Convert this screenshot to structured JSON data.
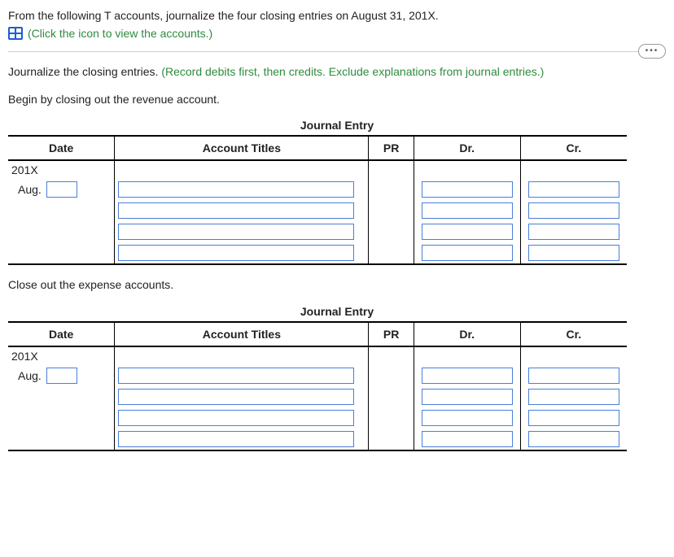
{
  "intro": {
    "line1": "From the following T accounts, journalize the four closing entries on August 31, 201X.",
    "link_text": "(Click the icon to view the accounts.)"
  },
  "main_instruction": "Journalize the closing entries.",
  "main_hint": " (Record debits first, then credits. Exclude explanations from journal entries.)",
  "step1_text": "Begin by closing out the revenue account.",
  "step2_text": "Close out the expense accounts.",
  "journal_caption": "Journal Entry",
  "headers": {
    "date": "Date",
    "titles": "Account Titles",
    "pr": "PR",
    "dr": "Dr.",
    "cr": "Cr."
  },
  "table1": {
    "year": "201X",
    "month": "Aug.",
    "rows": [
      {
        "day": "",
        "title": "",
        "dr": "",
        "cr": ""
      },
      {
        "day": null,
        "title": "",
        "dr": "",
        "cr": ""
      },
      {
        "day": null,
        "title": "",
        "dr": "",
        "cr": ""
      },
      {
        "day": null,
        "title": "",
        "dr": "",
        "cr": ""
      }
    ]
  },
  "table2": {
    "year": "201X",
    "month": "Aug.",
    "rows": [
      {
        "day": "",
        "title": "",
        "dr": "",
        "cr": ""
      },
      {
        "day": null,
        "title": "",
        "dr": "",
        "cr": ""
      },
      {
        "day": null,
        "title": "",
        "dr": "",
        "cr": ""
      },
      {
        "day": null,
        "title": "",
        "dr": "",
        "cr": ""
      }
    ]
  }
}
